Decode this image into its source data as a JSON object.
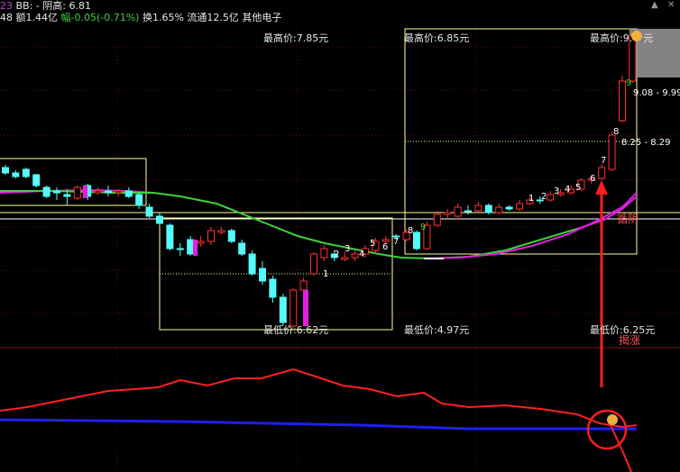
{
  "header": {
    "line1": {
      "num": "23",
      "bb": "BB: -",
      "yin": "阴高: 6.81"
    },
    "line2": {
      "vol": "48",
      "amount": "额1.44亿",
      "change": "幅-0.05(-0.71%)",
      "turnover": "换1.65%",
      "float": "流通12.5亿",
      "sector": "其他电子"
    }
  },
  "window_controls": {
    "up": "▲",
    "close": "✕"
  },
  "boxes": {
    "high_left": "最高价:7.85元",
    "high_mid": "最高价:6.85元",
    "high_right": "最高价:9.",
    "high_right_unit": "元",
    "low_left": "最低价:6.62元",
    "low_mid": "最低价:4.97元",
    "low_right": "最低价:6.25元"
  },
  "right_labels": {
    "range_high": "9.08 - 9.99",
    "range_low": "8.25 - 8.29",
    "signal_yin": "循阴",
    "signal_up": "揭涨"
  },
  "candle_count_labels": [
    "1",
    "2",
    "3",
    "4",
    "5",
    "6",
    "7",
    "8",
    "9"
  ],
  "colors": {
    "up": "#ff3030",
    "down": "#54fcfc",
    "ma_green": "#3cd23c",
    "ma_magenta": "#e020e0",
    "box_line": "#ffff99",
    "indicator_red": "#ff2020",
    "indicator_blue": "#1e1eff",
    "arrow": "#ff1e1e"
  },
  "chart_data": {
    "type": "candlestick",
    "price_marks": {
      "highs": [
        7.85,
        6.85,
        9.99
      ],
      "lows": [
        6.62,
        4.97,
        6.25
      ]
    },
    "ranges": [
      {
        "from": 9.08,
        "to": 9.99
      },
      {
        "from": 8.25,
        "to": 8.29
      }
    ],
    "candles": [
      {
        "o": 186,
        "c": 192,
        "h": 183,
        "l": 194
      },
      {
        "o": 192,
        "c": 196,
        "h": 189,
        "l": 198
      },
      {
        "o": 188,
        "c": 196,
        "h": 186,
        "l": 198
      },
      {
        "o": 194,
        "c": 206,
        "h": 193,
        "l": 208
      },
      {
        "o": 208,
        "c": 218,
        "h": 206,
        "l": 220
      },
      {
        "o": 212,
        "c": 214,
        "h": 208,
        "l": 222
      },
      {
        "o": 216,
        "c": 218,
        "h": 210,
        "l": 228
      },
      {
        "o": 220,
        "c": 208,
        "h": 206,
        "l": 222
      },
      {
        "o": 206,
        "c": 218,
        "h": 204,
        "l": 222
      },
      {
        "o": 214,
        "c": 212,
        "h": 208,
        "l": 216
      },
      {
        "o": 212,
        "c": 214,
        "h": 206,
        "l": 218
      },
      {
        "o": 214,
        "c": 212,
        "h": 210,
        "l": 218
      },
      {
        "o": 212,
        "c": 218,
        "h": 208,
        "l": 220
      },
      {
        "o": 216,
        "c": 228,
        "h": 214,
        "l": 232
      },
      {
        "o": 230,
        "c": 240,
        "h": 226,
        "l": 242
      },
      {
        "o": 240,
        "c": 248,
        "h": 236,
        "l": 250
      },
      {
        "o": 250,
        "c": 276,
        "h": 248,
        "l": 278
      },
      {
        "o": 276,
        "c": 276,
        "h": 270,
        "l": 284
      },
      {
        "o": 266,
        "c": 282,
        "h": 262,
        "l": 284
      },
      {
        "o": 270,
        "c": 268,
        "h": 262,
        "l": 274
      },
      {
        "o": 268,
        "c": 256,
        "h": 252,
        "l": 272
      },
      {
        "o": 258,
        "c": 256,
        "h": 252,
        "l": 260
      },
      {
        "o": 256,
        "c": 268,
        "h": 254,
        "l": 270
      },
      {
        "o": 270,
        "c": 282,
        "h": 266,
        "l": 284
      },
      {
        "o": 282,
        "c": 304,
        "h": 278,
        "l": 306
      },
      {
        "o": 298,
        "c": 312,
        "h": 290,
        "l": 316
      },
      {
        "o": 310,
        "c": 330,
        "h": 306,
        "l": 336
      },
      {
        "o": 330,
        "c": 358,
        "h": 326,
        "l": 362
      },
      {
        "o": 362,
        "c": 322,
        "h": 320,
        "l": 364
      },
      {
        "o": 322,
        "c": 312,
        "h": 308,
        "l": 326
      },
      {
        "o": 304,
        "c": 282,
        "h": 280,
        "l": 306
      },
      {
        "o": 286,
        "c": 276,
        "h": 272,
        "l": 290
      },
      {
        "o": 282,
        "c": 286,
        "h": 278,
        "l": 290
      },
      {
        "o": 288,
        "c": 286,
        "h": 280,
        "l": 290
      },
      {
        "o": 286,
        "c": 282,
        "h": 278,
        "l": 290
      },
      {
        "o": 282,
        "c": 276,
        "h": 272,
        "l": 286
      },
      {
        "o": 278,
        "c": 268,
        "h": 264,
        "l": 282
      },
      {
        "o": 268,
        "c": 266,
        "h": 262,
        "l": 270
      },
      {
        "o": 262,
        "c": 262,
        "h": 260,
        "l": 266
      },
      {
        "o": 266,
        "c": 258,
        "h": 254,
        "l": 268
      },
      {
        "o": 258,
        "c": 276,
        "h": 256,
        "l": 278
      },
      {
        "o": 276,
        "c": 250,
        "h": 246,
        "l": 278
      },
      {
        "o": 250,
        "c": 238,
        "h": 234,
        "l": 252
      },
      {
        "o": 238,
        "c": 236,
        "h": 232,
        "l": 242
      },
      {
        "o": 240,
        "c": 230,
        "h": 226,
        "l": 244
      },
      {
        "o": 234,
        "c": 234,
        "h": 228,
        "l": 238
      },
      {
        "o": 234,
        "c": 228,
        "h": 224,
        "l": 236
      },
      {
        "o": 228,
        "c": 236,
        "h": 226,
        "l": 238
      },
      {
        "o": 236,
        "c": 230,
        "h": 226,
        "l": 238
      },
      {
        "o": 230,
        "c": 232,
        "h": 228,
        "l": 234
      },
      {
        "o": 232,
        "c": 226,
        "h": 222,
        "l": 234
      },
      {
        "o": 226,
        "c": 222,
        "h": 218,
        "l": 228
      },
      {
        "o": 222,
        "c": 222,
        "h": 218,
        "l": 226
      },
      {
        "o": 222,
        "c": 216,
        "h": 212,
        "l": 224
      },
      {
        "o": 216,
        "c": 214,
        "h": 210,
        "l": 218
      },
      {
        "o": 214,
        "c": 210,
        "h": 206,
        "l": 216
      },
      {
        "o": 210,
        "c": 200,
        "h": 198,
        "l": 212
      },
      {
        "o": 200,
        "c": 198,
        "h": 196,
        "l": 204
      },
      {
        "o": 198,
        "c": 186,
        "h": 182,
        "l": 200
      },
      {
        "o": 188,
        "c": 150,
        "h": 146,
        "l": 190
      },
      {
        "o": 134,
        "c": 90,
        "h": 84,
        "l": 136
      },
      {
        "o": 90,
        "c": 40,
        "h": 34,
        "l": 92
      }
    ]
  }
}
